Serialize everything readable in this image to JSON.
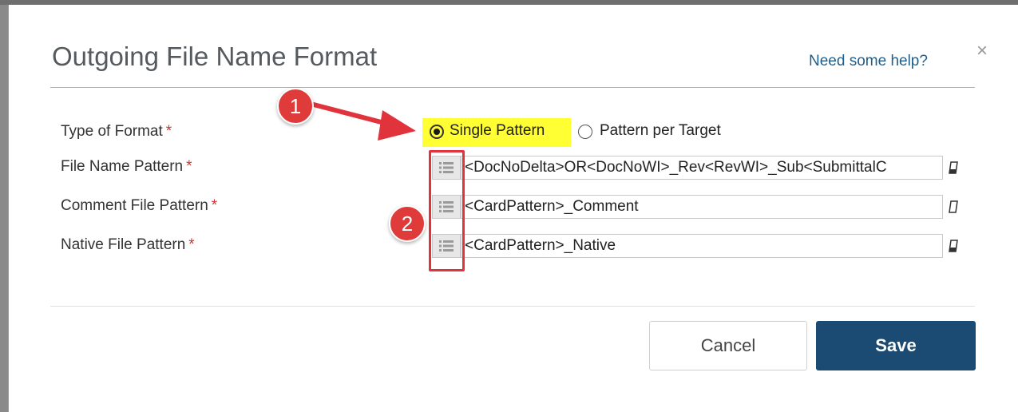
{
  "dialog": {
    "title": "Outgoing File Name Format",
    "help_link": "Need some help?",
    "close": "×"
  },
  "form": {
    "type_of_format": {
      "label": "Type of Format",
      "required": "*",
      "options": [
        {
          "label": "Single Pattern",
          "selected": true
        },
        {
          "label": "Pattern per Target",
          "selected": false
        }
      ]
    },
    "file_name_pattern": {
      "label": "File Name Pattern",
      "required": "*",
      "value": "<DocNoDelta>OR<DocNoWI>_Rev<RevWI>_Sub<SubmittalC"
    },
    "comment_file_pattern": {
      "label": "Comment File Pattern",
      "required": "*",
      "value": "<CardPattern>_Comment"
    },
    "native_file_pattern": {
      "label": "Native File Pattern",
      "required": "*",
      "value": "<CardPattern>_Native"
    }
  },
  "annotations": {
    "badge_1": "1",
    "badge_2": "2"
  },
  "footer": {
    "cancel_label": "Cancel",
    "save_label": "Save"
  },
  "colors": {
    "save_bg": "#1b4b72",
    "highlight": "#ffff33",
    "annotation_red": "#e0333b",
    "link": "#1f5e8a",
    "required": "#d0342c"
  },
  "icons": [
    "list-icon",
    "eraser-icon",
    "close-icon",
    "arrow-icon"
  ]
}
